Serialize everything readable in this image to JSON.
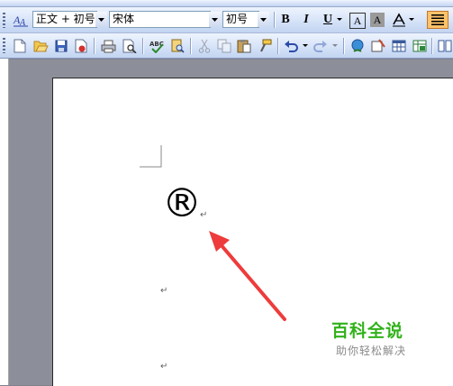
{
  "toolbar_format": {
    "style_value": "正文 + 初号",
    "font_value": "宋体",
    "size_value": "初号",
    "bold_label": "B",
    "italic_label": "I",
    "underline_label": "U",
    "char_border_label": "A",
    "char_shading_label": "A"
  },
  "document": {
    "registered_symbol": "®",
    "paragraph_mark": "↵"
  },
  "watermark": {
    "title": "百科全说",
    "subtitle": "助你轻松解决"
  },
  "colors": {
    "toolbar_top": "#eef4fe",
    "toolbar_bottom": "#c2d4f1",
    "arrow": "#ee3b3b",
    "watermark_green": "#31b21a",
    "workspace_gray": "#8c8f99"
  },
  "icons": [
    "styles-pane-icon",
    "new-document-icon",
    "open-folder-icon",
    "save-icon",
    "permission-icon",
    "print-icon",
    "print-preview-icon",
    "spelling-icon",
    "research-icon",
    "cut-icon",
    "copy-icon",
    "paste-icon",
    "format-painter-icon",
    "undo-icon",
    "redo-icon",
    "hyperlink-icon",
    "tables-borders-icon",
    "insert-table-icon",
    "insert-excel-icon",
    "columns-icon"
  ]
}
